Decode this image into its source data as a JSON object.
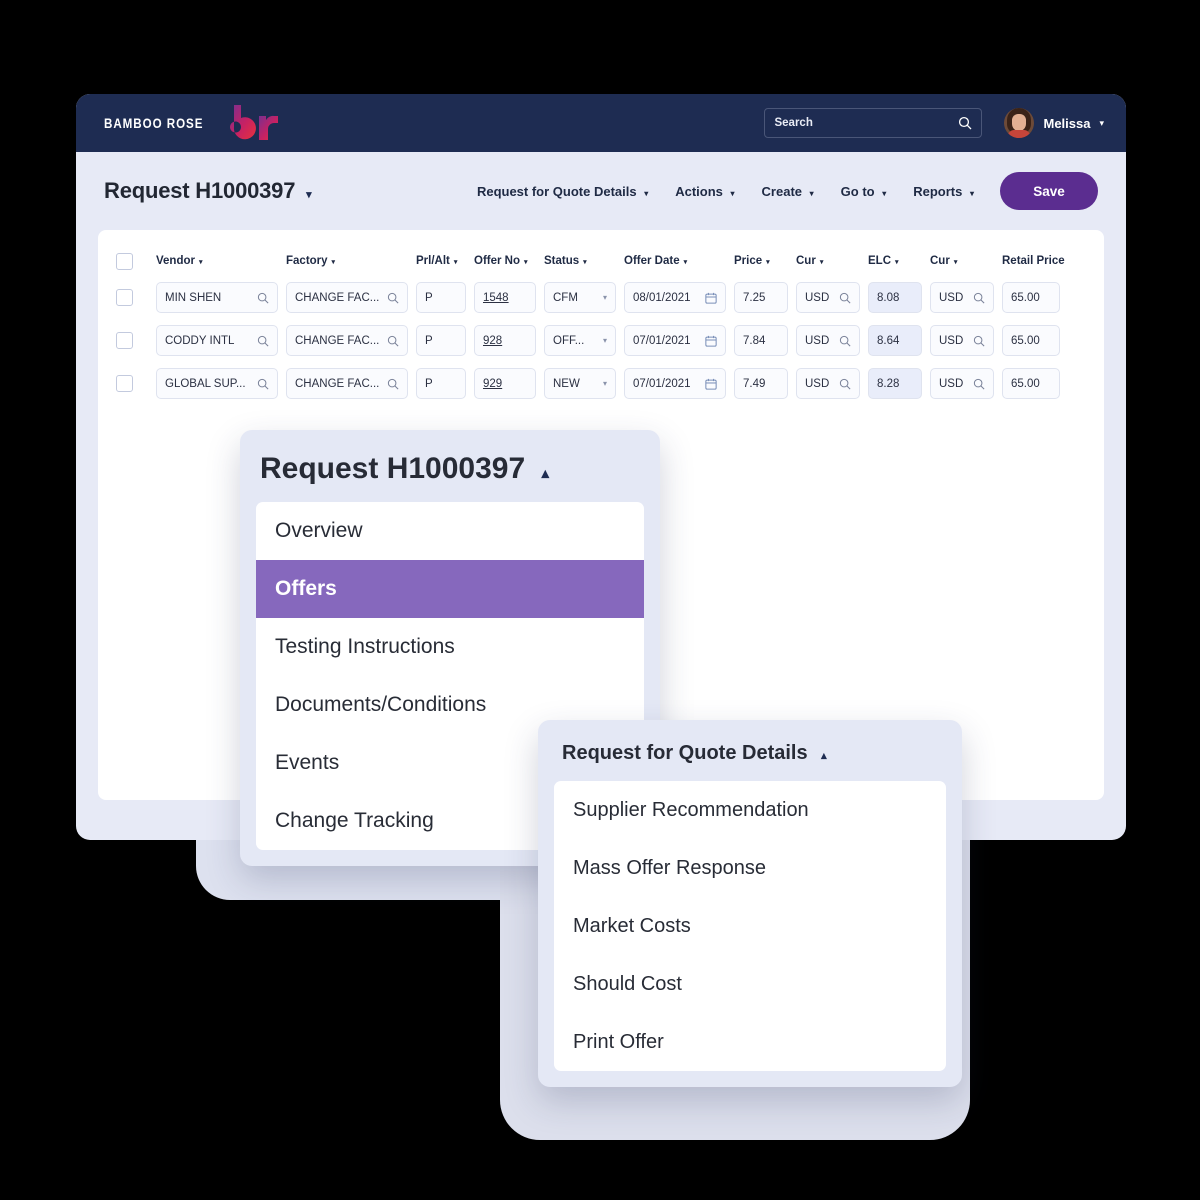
{
  "topbar": {
    "logo_text": "BAMBOO ROSE",
    "logo_mark": "br-logo-icon",
    "search": {
      "placeholder": "Search",
      "value": "",
      "icon": "search-icon"
    },
    "user": {
      "name": "Melissa",
      "caret": "▾",
      "avatar": "user-avatar"
    }
  },
  "header": {
    "title": "Request H1000397",
    "title_caret": "▾",
    "nav": [
      {
        "label": "Request for Quote Details",
        "caret": "▾"
      },
      {
        "label": "Actions",
        "caret": "▾"
      },
      {
        "label": "Create",
        "caret": "▾"
      },
      {
        "label": "Go to",
        "caret": "▾"
      },
      {
        "label": "Reports",
        "caret": "▾"
      }
    ],
    "save_label": "Save",
    "save_color": "#5b2d90"
  },
  "grid": {
    "caret": "▾",
    "columns": [
      {
        "key": "check",
        "label": ""
      },
      {
        "key": "vendor",
        "label": "Vendor",
        "sortable": true
      },
      {
        "key": "factory",
        "label": "Factory",
        "sortable": true
      },
      {
        "key": "prl",
        "label": "Prl/Alt",
        "sortable": true
      },
      {
        "key": "offer",
        "label": "Offer No",
        "sortable": true
      },
      {
        "key": "status",
        "label": "Status",
        "sortable": true
      },
      {
        "key": "date",
        "label": "Offer Date",
        "sortable": true
      },
      {
        "key": "price",
        "label": "Price",
        "sortable": true
      },
      {
        "key": "cur",
        "label": "Cur",
        "sortable": true
      },
      {
        "key": "elc",
        "label": "ELC",
        "sortable": true
      },
      {
        "key": "cur2",
        "label": "Cur",
        "sortable": true
      },
      {
        "key": "retail",
        "label": "Retail Price",
        "sortable": false
      }
    ],
    "rows": [
      {
        "vendor": "MIN SHEN",
        "factory": "CHANGE FAC...",
        "prl": "P",
        "offer": "1548",
        "status": "CFM",
        "date": "08/01/2021",
        "price": "7.25",
        "cur": "USD",
        "elc": "8.08",
        "cur2": "USD",
        "retail": "65.00"
      },
      {
        "vendor": "CODDY INTL",
        "factory": "CHANGE FAC...",
        "prl": "P",
        "offer": "928",
        "status": "OFF...",
        "date": "07/01/2021",
        "price": "7.84",
        "cur": "USD",
        "elc": "8.64",
        "cur2": "USD",
        "retail": "65.00"
      },
      {
        "vendor": "GLOBAL SUP...",
        "factory": "CHANGE FAC...",
        "prl": "P",
        "offer": "929",
        "status": "NEW",
        "date": "07/01/2021",
        "price": "7.49",
        "cur": "USD",
        "elc": "8.28",
        "cur2": "USD",
        "retail": "65.00"
      }
    ]
  },
  "panel_nav": {
    "title": "Request H1000397",
    "caret": "▴",
    "items": [
      {
        "label": "Overview",
        "active": false
      },
      {
        "label": "Offers",
        "active": true
      },
      {
        "label": "Testing Instructions",
        "active": false
      },
      {
        "label": "Documents/Conditions",
        "active": false
      },
      {
        "label": "Events",
        "active": false
      },
      {
        "label": "Change Tracking",
        "active": false
      }
    ],
    "active_color": "#8668bd"
  },
  "panel_rfq": {
    "title": "Request for Quote Details",
    "caret": "▴",
    "items": [
      {
        "label": "Supplier Recommendation"
      },
      {
        "label": "Mass Offer Response"
      },
      {
        "label": "Market Costs"
      },
      {
        "label": "Should Cost"
      },
      {
        "label": "Print Offer"
      }
    ]
  }
}
